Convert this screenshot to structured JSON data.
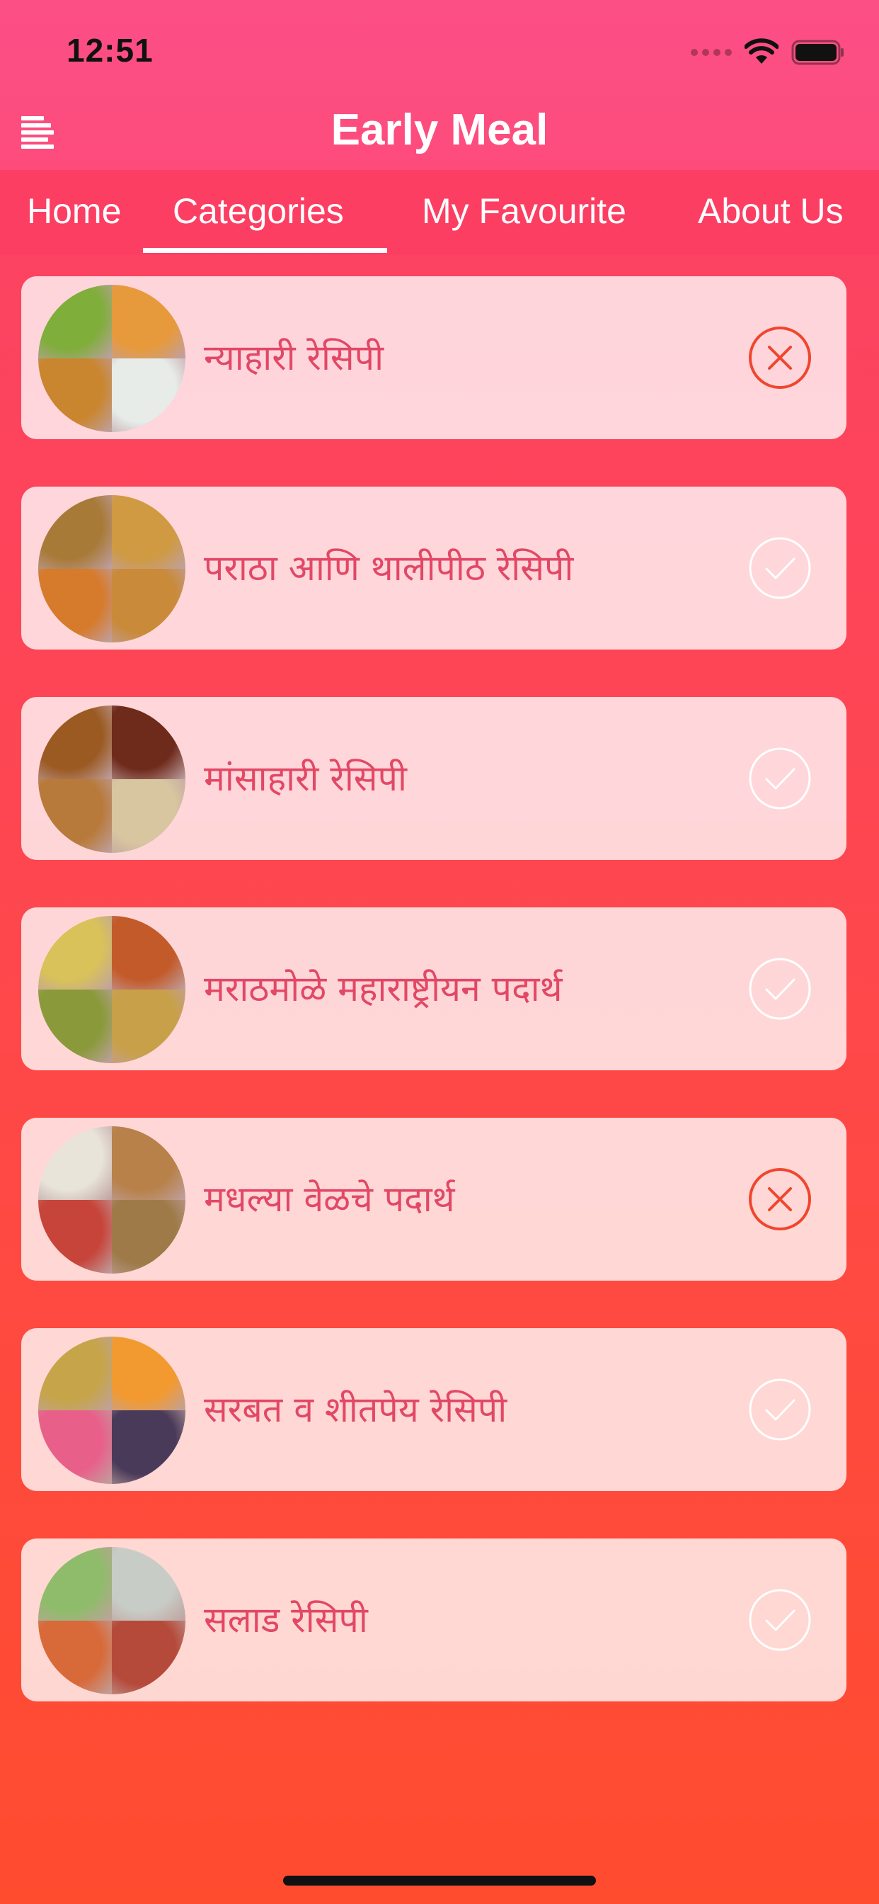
{
  "status_bar": {
    "time": "12:51"
  },
  "header": {
    "title": "Early Meal",
    "menu_icon": "menu-lines-icon"
  },
  "tabs": [
    {
      "label": "Home",
      "selected": false
    },
    {
      "label": "Categories",
      "selected": true
    },
    {
      "label": "My Favourite",
      "selected": false
    },
    {
      "label": "About Us",
      "selected": false
    }
  ],
  "categories": [
    {
      "label": "न्याहारी रेसिपी",
      "status": "excluded",
      "icon": "close-circle-icon",
      "thumb_colors": [
        "#7fae3a",
        "#e79a3c",
        "#c9862f",
        "#e7ece9"
      ]
    },
    {
      "label": "पराठा आणि थालीपीठ रेसिपी",
      "status": "included",
      "icon": "check-circle-icon",
      "thumb_colors": [
        "#a87a38",
        "#cf9a42",
        "#d67a2b",
        "#c98a3a"
      ]
    },
    {
      "label": "मांसाहारी रेसिपी",
      "status": "included",
      "icon": "check-circle-icon",
      "thumb_colors": [
        "#9b5a22",
        "#6e2a1a",
        "#b87a3a",
        "#d8c6a0"
      ]
    },
    {
      "label": "मराठमोळे महाराष्ट्रीयन पदार्थ",
      "status": "included",
      "icon": "check-circle-icon",
      "thumb_colors": [
        "#d9c25a",
        "#c35a2a",
        "#8a9a3a",
        "#c9a04a"
      ]
    },
    {
      "label": "मधल्या वेळचे पदार्थ",
      "status": "excluded",
      "icon": "close-circle-icon",
      "thumb_colors": [
        "#e8e4da",
        "#b8814a",
        "#c7443a",
        "#9e7a48"
      ]
    },
    {
      "label": "सरबत व शीतपेय रेसिपी",
      "status": "included",
      "icon": "check-circle-icon",
      "thumb_colors": [
        "#c6a54a",
        "#f29a30",
        "#e8608a",
        "#4a3a5a"
      ]
    },
    {
      "label": "सलाड रेसिपी",
      "status": "included",
      "icon": "check-circle-icon",
      "thumb_colors": [
        "#8fbc6a",
        "#c8ccc6",
        "#d86a3a",
        "#b54a3a"
      ]
    }
  ],
  "colors": {
    "header": "#fc4f86",
    "tab_bar": "#fd3e63",
    "label_text": "#e24866",
    "excluded_icon": "#f0462e",
    "included_icon": "#ffffff"
  }
}
